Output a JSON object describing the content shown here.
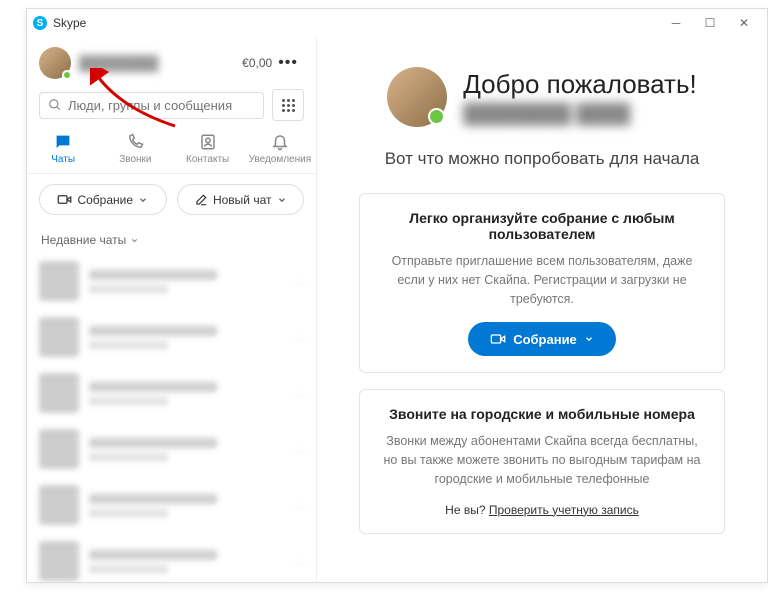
{
  "titlebar": {
    "app_name": "Skype"
  },
  "profile": {
    "name": "████████",
    "credit": "€0,00",
    "status": "online"
  },
  "search": {
    "placeholder": "Люди, группы и сообщения"
  },
  "tabs": {
    "chats": "Чаты",
    "calls": "Звонки",
    "contacts": "Контакты",
    "notifications": "Уведомления"
  },
  "buttons": {
    "meeting": "Собрание",
    "new_chat": "Новый чат"
  },
  "recent_header": "Недавние чаты",
  "chat_items": [
    0,
    1,
    2,
    3,
    4,
    5
  ],
  "welcome": {
    "title": "Добро пожаловать!",
    "username": "████████ ████",
    "subtitle": "Вот что можно попробовать для начала"
  },
  "card1": {
    "title": "Легко организуйте собрание с любым пользователем",
    "text": "Отправьте приглашение всем пользователям, даже если у них нет Скайпа. Регистрации и загрузки не требуются.",
    "button": "Собрание"
  },
  "card2": {
    "title": "Звоните на городские и мобильные номера",
    "text": "Звонки между абонентами Скайпа всегда бесплатны, но вы также можете звонить по выгодным тарифам на городские и мобильные телефонные",
    "not_you": "Не вы?",
    "check_account": "Проверить учетную запись"
  }
}
